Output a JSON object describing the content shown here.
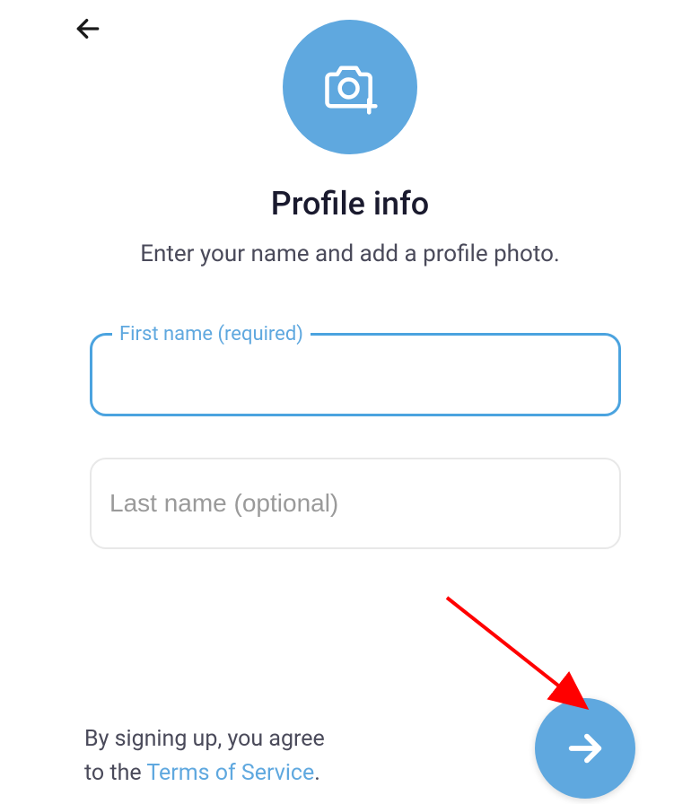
{
  "header": {
    "title": "Profile info",
    "subtitle": "Enter your name and add a profile photo."
  },
  "fields": {
    "first_name": {
      "label": "First name (required)",
      "value": ""
    },
    "last_name": {
      "placeholder": "Last name (optional)",
      "value": ""
    }
  },
  "tos": {
    "prefix1": "By signing up, you agree",
    "prefix2": "to the ",
    "link": "Terms of Service",
    "suffix": "."
  },
  "colors": {
    "accent": "#5fa8df",
    "annotation": "#ff0000"
  }
}
